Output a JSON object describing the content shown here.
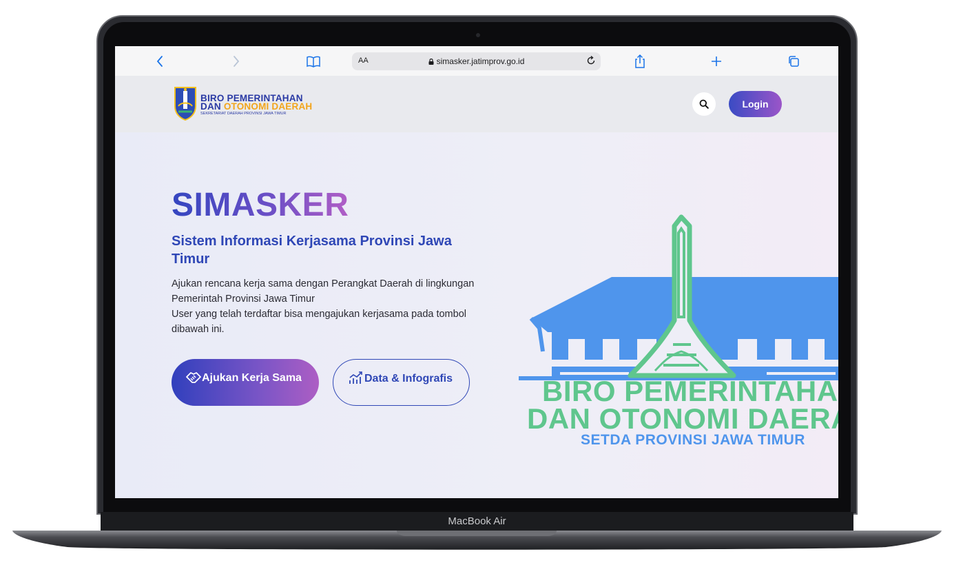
{
  "device": {
    "label": "MacBook Air"
  },
  "browser": {
    "text_size_label": "AA",
    "url": "simasker.jatimprov.go.id"
  },
  "header": {
    "logo_line1": "BIRO PEMERINTAHAN",
    "logo_line2_a": "DAN",
    "logo_line2_b": "OTONOMI DAERAH",
    "logo_line3": "SEKRETARIAT DAERAH PROVINSI JAWA TIMUR",
    "login_label": "Login"
  },
  "hero": {
    "title": "SIMASKER",
    "subtitle": "Sistem Informasi Kerjasama Provinsi Jawa Timur",
    "desc_line1": "Ajukan rencana kerja sama dengan Perangkat Daerah di lingkungan Pemerintah Provinsi Jawa Timur",
    "desc_line2": "User yang telah terdaftar bisa mengajukan kerjasama pada tombol dibawah ini.",
    "primary_button": "Ajukan Kerja Sama",
    "secondary_button": "Data & Infografis"
  },
  "illustration": {
    "line1": "BIRO PEMERINTAHAN",
    "line2": "DAN OTONOMI DAERAH",
    "line3": "SETDA PROVINSI JAWA TIMUR"
  },
  "colors": {
    "brand_blue": "#2f47b6",
    "brand_purple": "#9b55c8",
    "illustration_green": "#5fc68d",
    "illustration_blue": "#4f95ec",
    "logo_accent": "#f2a51c"
  }
}
